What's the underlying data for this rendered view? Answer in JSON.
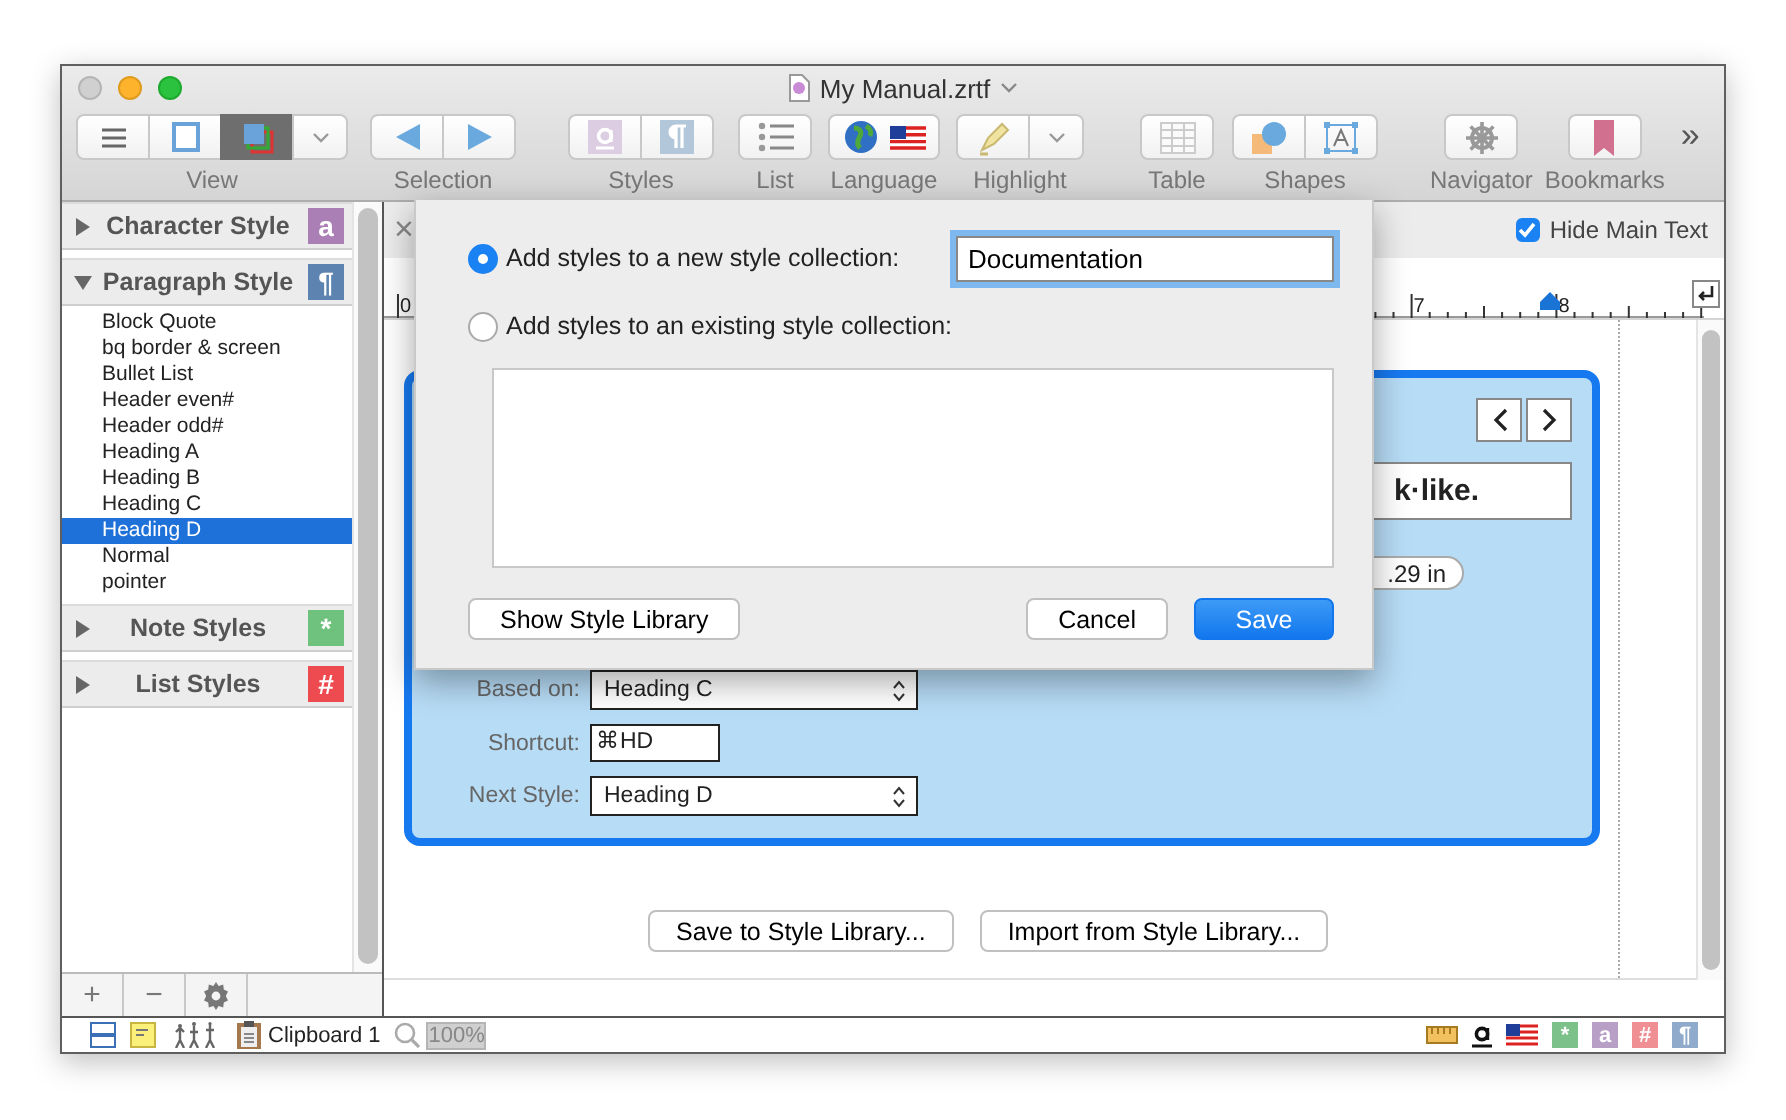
{
  "window": {
    "title": "My Manual.zrtf"
  },
  "toolbar": [
    {
      "kind": "view",
      "label": "View",
      "segments": [
        {
          "selected": false
        },
        {
          "selected": false
        },
        {
          "selected": true
        }
      ]
    },
    {
      "kind": "selection",
      "label": "Selection"
    },
    {
      "kind": "styles",
      "label": "Styles"
    },
    {
      "kind": "list",
      "label": "List"
    },
    {
      "kind": "language",
      "label": "Language"
    },
    {
      "kind": "highlight",
      "label": "Highlight"
    },
    {
      "kind": "table",
      "label": "Table"
    },
    {
      "kind": "shapes",
      "label": "Shapes"
    },
    {
      "kind": "navigator",
      "label": "Navigator"
    },
    {
      "kind": "bookmarks",
      "label": "Bookmarks"
    }
  ],
  "toolbar_overflow": "»",
  "sidebar": {
    "sections": [
      {
        "title": "Character Style",
        "expanded": false,
        "badge": "a",
        "color": "#a97fb5"
      },
      {
        "title": "Paragraph Style",
        "expanded": true,
        "badge": "¶",
        "color": "#5d84b0",
        "items": [
          {
            "label": "Block Quote",
            "selected": false
          },
          {
            "label": "bq border & screen",
            "selected": false
          },
          {
            "label": "Bullet List",
            "selected": false
          },
          {
            "label": "Header even#",
            "selected": false
          },
          {
            "label": "Header odd#",
            "selected": false
          },
          {
            "label": "Heading A",
            "selected": false
          },
          {
            "label": "Heading B",
            "selected": false
          },
          {
            "label": "Heading C",
            "selected": false
          },
          {
            "label": "Heading D",
            "selected": true
          },
          {
            "label": "Normal",
            "selected": false
          },
          {
            "label": "pointer",
            "selected": false
          }
        ]
      },
      {
        "title": "Note Styles",
        "expanded": false,
        "badge": "*",
        "color": "#6fc27d"
      },
      {
        "title": "List Styles",
        "expanded": false,
        "badge": "#",
        "color": "#ee4b50"
      }
    ],
    "footer_buttons": [
      "+",
      "−"
    ]
  },
  "main": {
    "close": "×",
    "hide_main_text": {
      "label": "Hide Main Text",
      "checked": true
    },
    "ruler": {
      "labels": [
        "0",
        "7",
        "8"
      ]
    },
    "style_editor": {
      "preview_text": "k·like.",
      "measure": ".29 in",
      "fields": [
        {
          "label": "Based on:",
          "kind": "select",
          "value": "Heading C"
        },
        {
          "label": "Shortcut:",
          "kind": "text",
          "value": "⌘HD"
        },
        {
          "label": "Next Style:",
          "kind": "select",
          "value": "Heading D"
        }
      ]
    },
    "buttons": [
      "Save to Style Library...",
      "Import from Style Library..."
    ]
  },
  "dialog": {
    "options": [
      {
        "label": "Add styles to a new style collection:",
        "selected": true
      },
      {
        "label": "Add styles to an existing style collection:",
        "selected": false
      }
    ],
    "collection_name": "Documentation",
    "buttons": [
      {
        "label": "Show Style Library",
        "kind": "plain"
      },
      {
        "label": "Cancel",
        "kind": "plain"
      },
      {
        "label": "Save",
        "kind": "primary"
      }
    ]
  },
  "status_bar": {
    "clipboard": "Clipboard 1",
    "zoom": "100%",
    "badges": [
      {
        "glyph": "*",
        "color": "#7cc18a"
      },
      {
        "glyph": "a",
        "color": "#b79fc6"
      },
      {
        "glyph": "#",
        "color": "#ef8e93"
      },
      {
        "glyph": "¶",
        "color": "#8faacb"
      }
    ]
  }
}
